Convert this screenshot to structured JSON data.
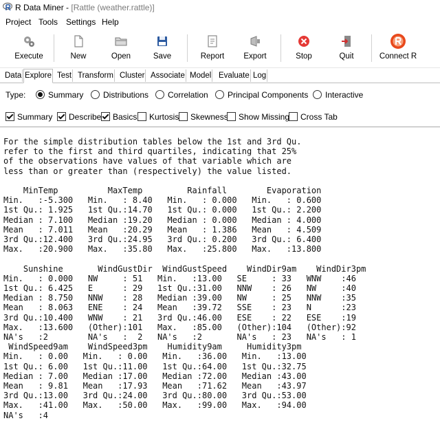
{
  "window": {
    "title": "R Data Miner - ",
    "title_dim": "[Rattle (weather.rattle)]"
  },
  "menu": [
    "Project",
    "Tools",
    "Settings",
    "Help"
  ],
  "toolbar": [
    {
      "label": "Execute",
      "icon": "gears-icon"
    },
    {
      "label": "New",
      "icon": "new-file-icon"
    },
    {
      "label": "Open",
      "icon": "folder-open-icon"
    },
    {
      "label": "Save",
      "icon": "floppy-disk-icon"
    },
    {
      "label": "Report",
      "icon": "report-icon"
    },
    {
      "label": "Export",
      "icon": "export-icon"
    },
    {
      "label": "Stop",
      "icon": "stop-icon"
    },
    {
      "label": "Quit",
      "icon": "quit-door-icon"
    },
    {
      "label": "Connect R",
      "icon": "r-logo-icon"
    }
  ],
  "tabs": [
    "Data",
    "Explore",
    "Test",
    "Transform",
    "Cluster",
    "Associate",
    "Model",
    "Evaluate",
    "Log"
  ],
  "active_tab": "Explore",
  "type_label": "Type:",
  "type_options": [
    "Summary",
    "Distributions",
    "Correlation",
    "Principal Components",
    "Interactive"
  ],
  "selected_type": "Summary",
  "checkboxes": [
    {
      "label": "Summary",
      "checked": true
    },
    {
      "label": "Describe",
      "checked": true
    },
    {
      "label": "Basics",
      "checked": true
    },
    {
      "label": "Kurtosis",
      "checked": false
    },
    {
      "label": "Skewness",
      "checked": false
    },
    {
      "label": "Show Missing",
      "checked": false
    },
    {
      "label": "Cross Tab",
      "checked": false
    }
  ],
  "output_lines": [
    "For the simple distribution tables below the 1st and 3rd Qu.",
    "refer to the first and third quartiles, indicating that 25%",
    "of the observations have values of that variable which are",
    "less than or greater than (respectively) the value listed.",
    "",
    "    MinTemp          MaxTemp         Rainfall        Evaporation",
    "Min.   :-5.300   Min.   : 8.40   Min.   : 0.000   Min.   : 0.600",
    "1st Qu.: 1.925   1st Qu.:14.70   1st Qu.: 0.000   1st Qu.: 2.200",
    "Median : 7.100   Median :19.20   Median : 0.000   Median : 4.000",
    "Mean   : 7.011   Mean   :20.29   Mean   : 1.386   Mean   : 4.509",
    "3rd Qu.:12.400   3rd Qu.:24.95   3rd Qu.: 0.200   3rd Qu.: 6.400",
    "Max.   :20.900   Max.   :35.80   Max.   :25.800   Max.   :13.800",
    "",
    "    Sunshine       WindGustDir  WindGustSpeed    WindDir9am    WindDir3pm",
    "Min.   : 0.000   NW     : 51   Min.   :13.00   SE     : 33   WNW    :46",
    "1st Qu.: 6.425   E      : 29   1st Qu.:31.00   NNW    : 26   NW     :40",
    "Median : 8.750   NNW    : 28   Median :39.00   NW     : 25   NNW    :35",
    "Mean   : 8.063   ENE    : 24   Mean   :39.72   SSE    : 23   N      :23",
    "3rd Qu.:10.400   WNW    : 21   3rd Qu.:46.00   ESE    : 22   ESE    :19",
    "Max.   :13.600   (Other):101   Max.   :85.00   (Other):104   (Other):92",
    "NA's   :2        NA's   :  2   NA's   :2       NA's   : 23   NA's   : 1",
    " WindSpeed9am    WindSpeed3pm    Humidity9am     Humidity3pm",
    "Min.   : 0.00   Min.   : 0.00   Min.   :36.00   Min.   :13.00",
    "1st Qu.: 6.00   1st Qu.:11.00   1st Qu.:64.00   1st Qu.:32.75",
    "Median : 7.00   Median :17.00   Median :72.00   Median :43.00",
    "Mean   : 9.81   Mean   :17.93   Mean   :71.62   Mean   :43.97",
    "3rd Qu.:13.00   3rd Qu.:24.00   3rd Qu.:80.00   3rd Qu.:53.00",
    "Max.   :41.00   Max.   :50.00   Max.   :99.00   Max.   :94.00",
    "NA's   :4"
  ],
  "colors": {
    "stop": "#e53935",
    "connect_r": "#e8481b",
    "save": "#2c5aa0"
  }
}
